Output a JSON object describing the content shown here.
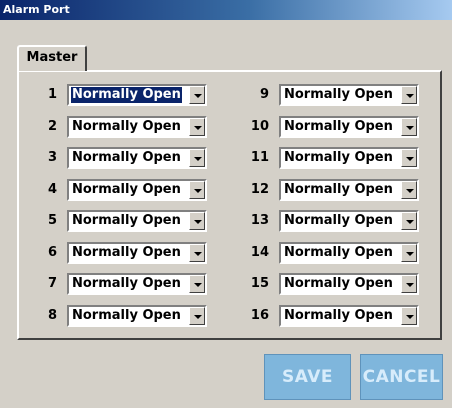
{
  "window": {
    "title": "Alarm Port"
  },
  "tabs": [
    {
      "label": "Master"
    }
  ],
  "ports": [
    {
      "number": "1",
      "value": "Normally Open",
      "selected": true
    },
    {
      "number": "2",
      "value": "Normally Open"
    },
    {
      "number": "3",
      "value": "Normally Open"
    },
    {
      "number": "4",
      "value": "Normally Open"
    },
    {
      "number": "5",
      "value": "Normally Open"
    },
    {
      "number": "6",
      "value": "Normally Open"
    },
    {
      "number": "7",
      "value": "Normally Open"
    },
    {
      "number": "8",
      "value": "Normally Open"
    },
    {
      "number": "9",
      "value": "Normally Open"
    },
    {
      "number": "10",
      "value": "Normally Open"
    },
    {
      "number": "11",
      "value": "Normally Open"
    },
    {
      "number": "12",
      "value": "Normally Open"
    },
    {
      "number": "13",
      "value": "Normally Open"
    },
    {
      "number": "14",
      "value": "Normally Open"
    },
    {
      "number": "15",
      "value": "Normally Open"
    },
    {
      "number": "16",
      "value": "Normally Open"
    }
  ],
  "actions": {
    "save_label": "SAVE",
    "cancel_label": "CANCEL"
  },
  "colors": {
    "title_bar": "#0a246a",
    "selection": "#0a246a",
    "button_bg": "#7fb6dc",
    "button_text": "#d7ecfb"
  },
  "icons": {
    "dropdown": "chevron-down-icon"
  }
}
